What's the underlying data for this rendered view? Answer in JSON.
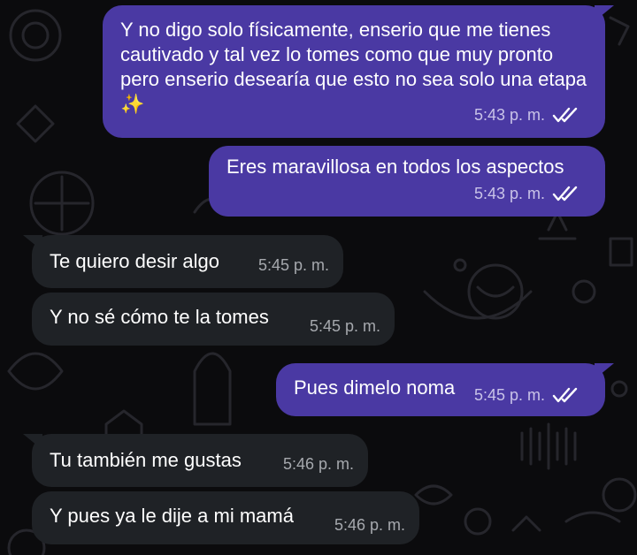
{
  "colors": {
    "background": "#0b0b0d",
    "outgoing_bubble": "#4a39a3",
    "incoming_bubble": "#1f2226",
    "read_ticks": "#ffffff"
  },
  "messages": [
    {
      "direction": "outgoing",
      "text": "Y no digo solo físicamente, enserio que me tienes cautivado y tal vez lo tomes como que muy pronto pero enserio desearía que esto no sea solo una etapa ✨",
      "time": "5:43 p. m.",
      "status_icon": "double-check-icon"
    },
    {
      "direction": "outgoing",
      "text": "Eres maravillosa en todos los aspectos",
      "time": "5:43 p. m.",
      "status_icon": "double-check-icon"
    },
    {
      "direction": "incoming",
      "text": "Te quiero desir algo",
      "time": "5:45 p. m."
    },
    {
      "direction": "incoming",
      "text": "Y no sé cómo te la tomes",
      "time": "5:45 p. m."
    },
    {
      "direction": "outgoing",
      "text": "Pues dimelo noma",
      "time": "5:45 p. m.",
      "status_icon": "double-check-icon"
    },
    {
      "direction": "incoming",
      "text": "Tu también me gustas",
      "time": "5:46 p. m."
    },
    {
      "direction": "incoming",
      "text": "Y pues ya le dije a mi mamá",
      "time": "5:46 p. m."
    }
  ]
}
